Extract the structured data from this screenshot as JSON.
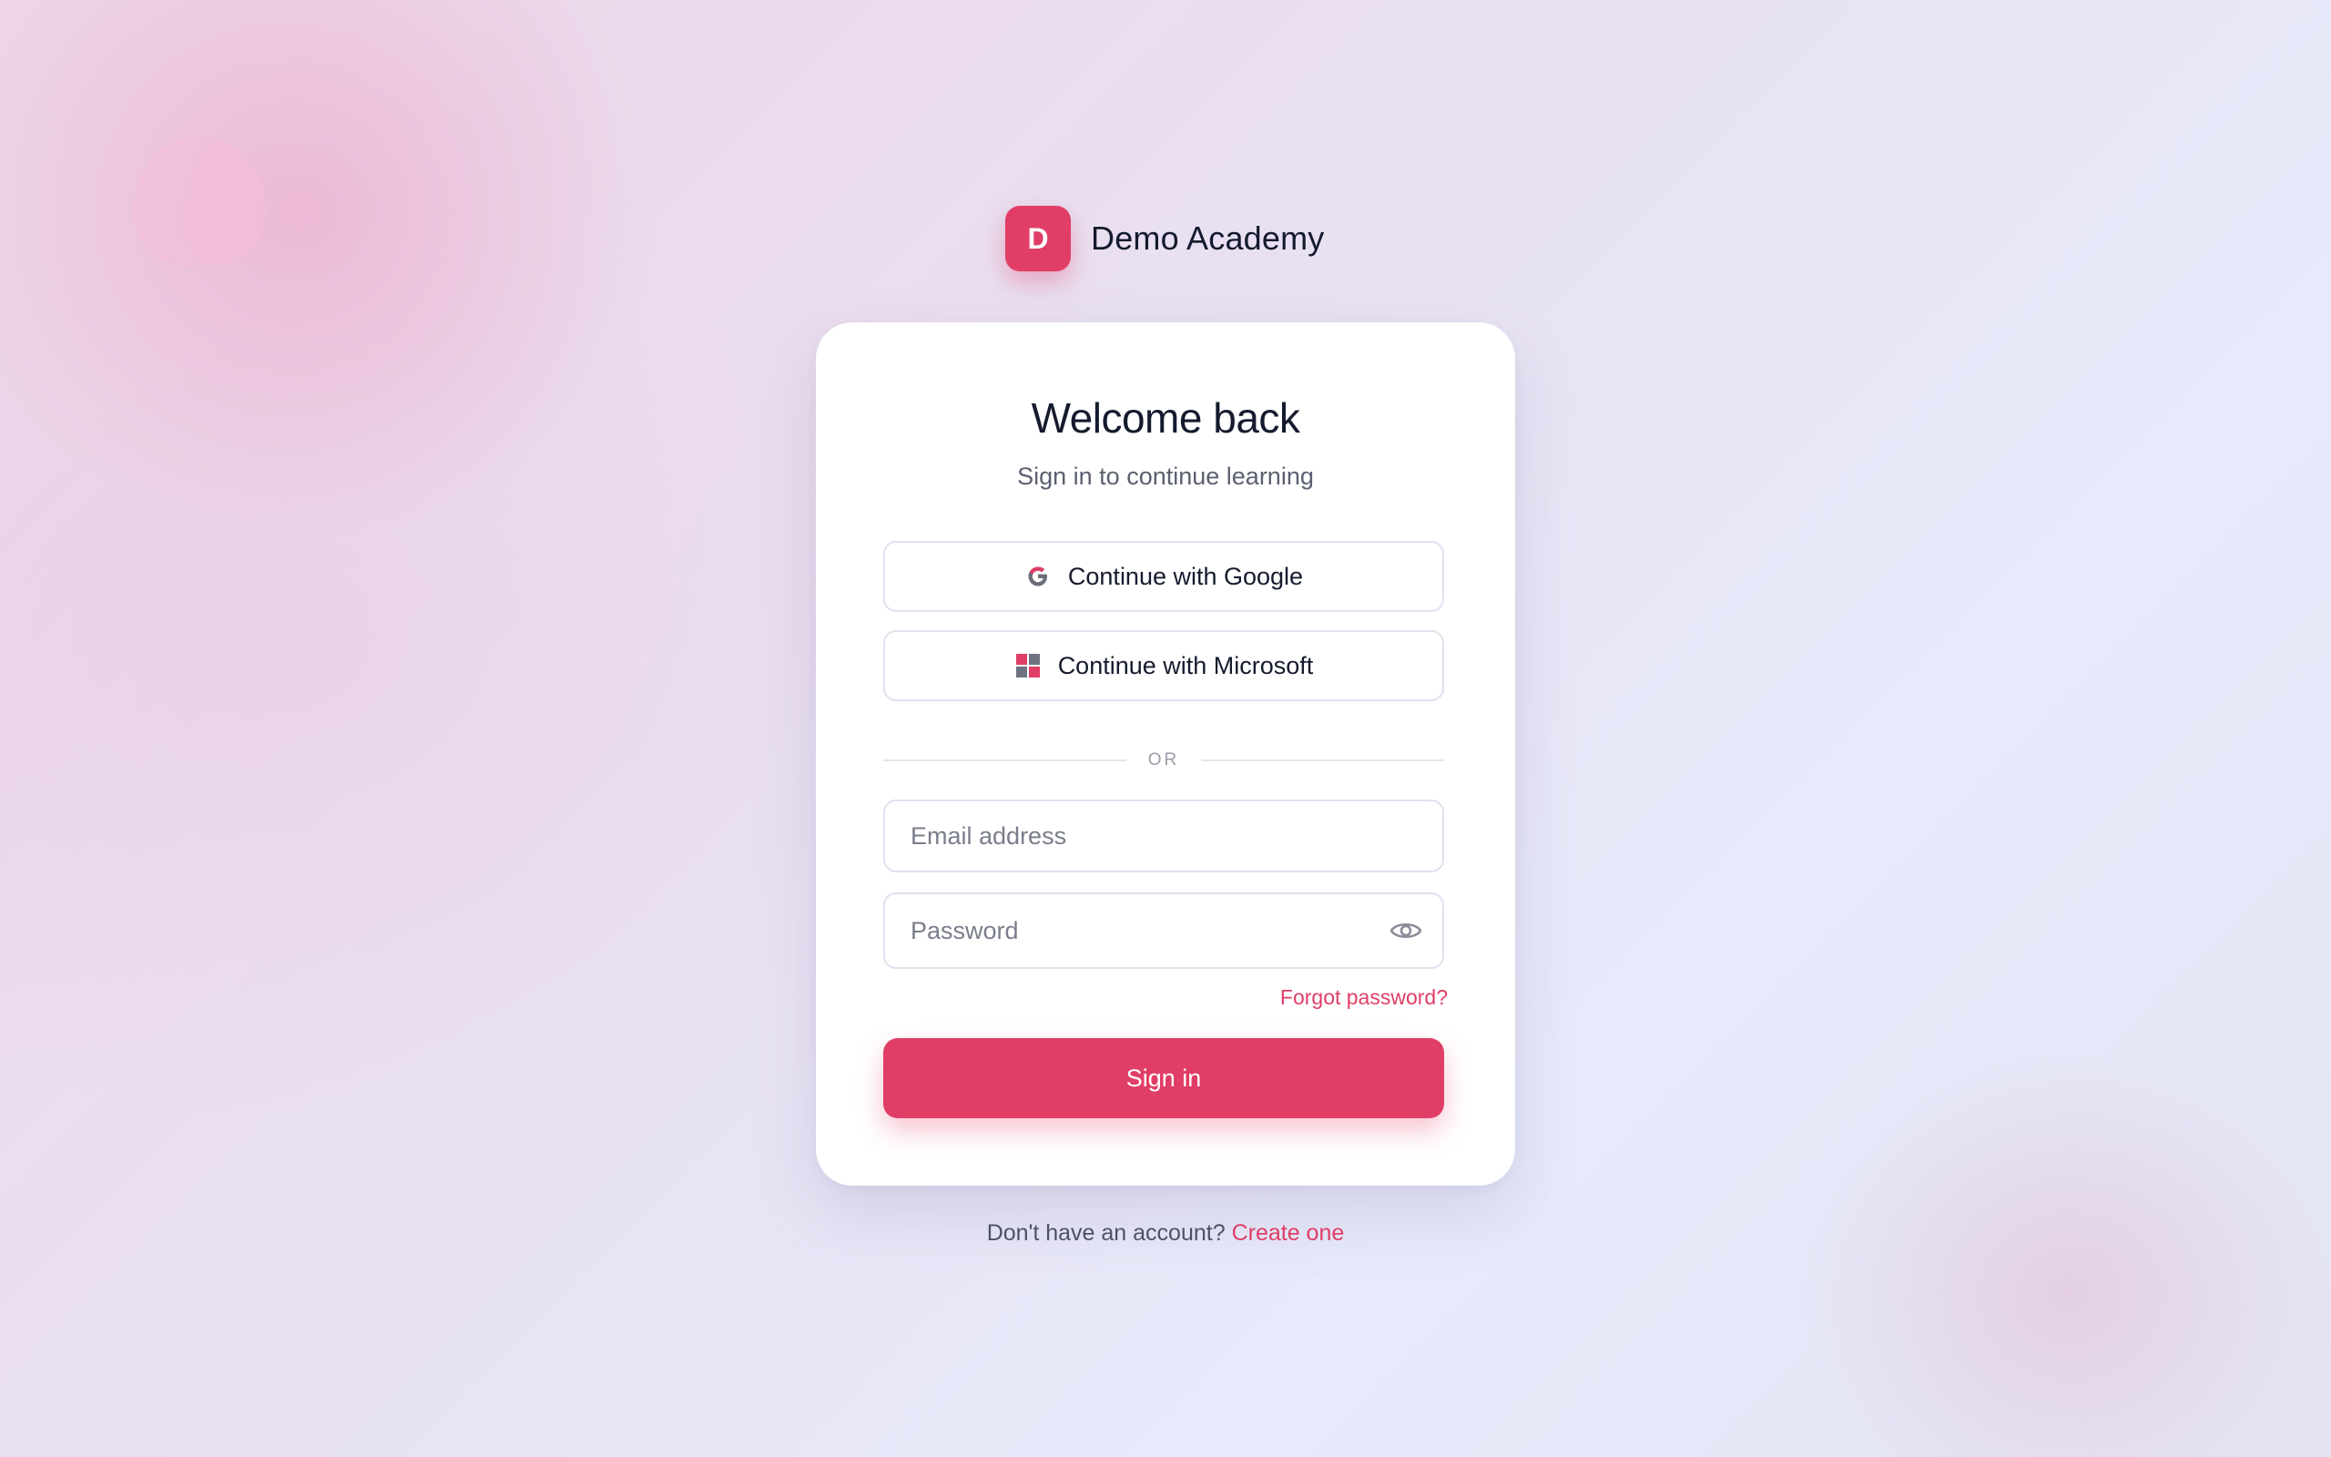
{
  "brand": {
    "logo_letter": "D",
    "name": "Demo Academy",
    "accent_color": "#e03e66"
  },
  "card": {
    "title": "Welcome back",
    "subtitle": "Sign in to continue learning"
  },
  "oauth": {
    "google_label": "Continue with Google",
    "google_icon": "google-icon",
    "microsoft_label": "Continue with Microsoft",
    "microsoft_icon": "microsoft-icon"
  },
  "divider": {
    "text": "OR"
  },
  "form": {
    "email_placeholder": "Email address",
    "email_value": "",
    "password_placeholder": "Password",
    "password_value": "",
    "password_toggle_icon": "eye-icon",
    "forgot_label": "Forgot password?",
    "submit_label": "Sign in"
  },
  "footer": {
    "prompt": "Don't have an account?",
    "link_label": "Create one"
  }
}
